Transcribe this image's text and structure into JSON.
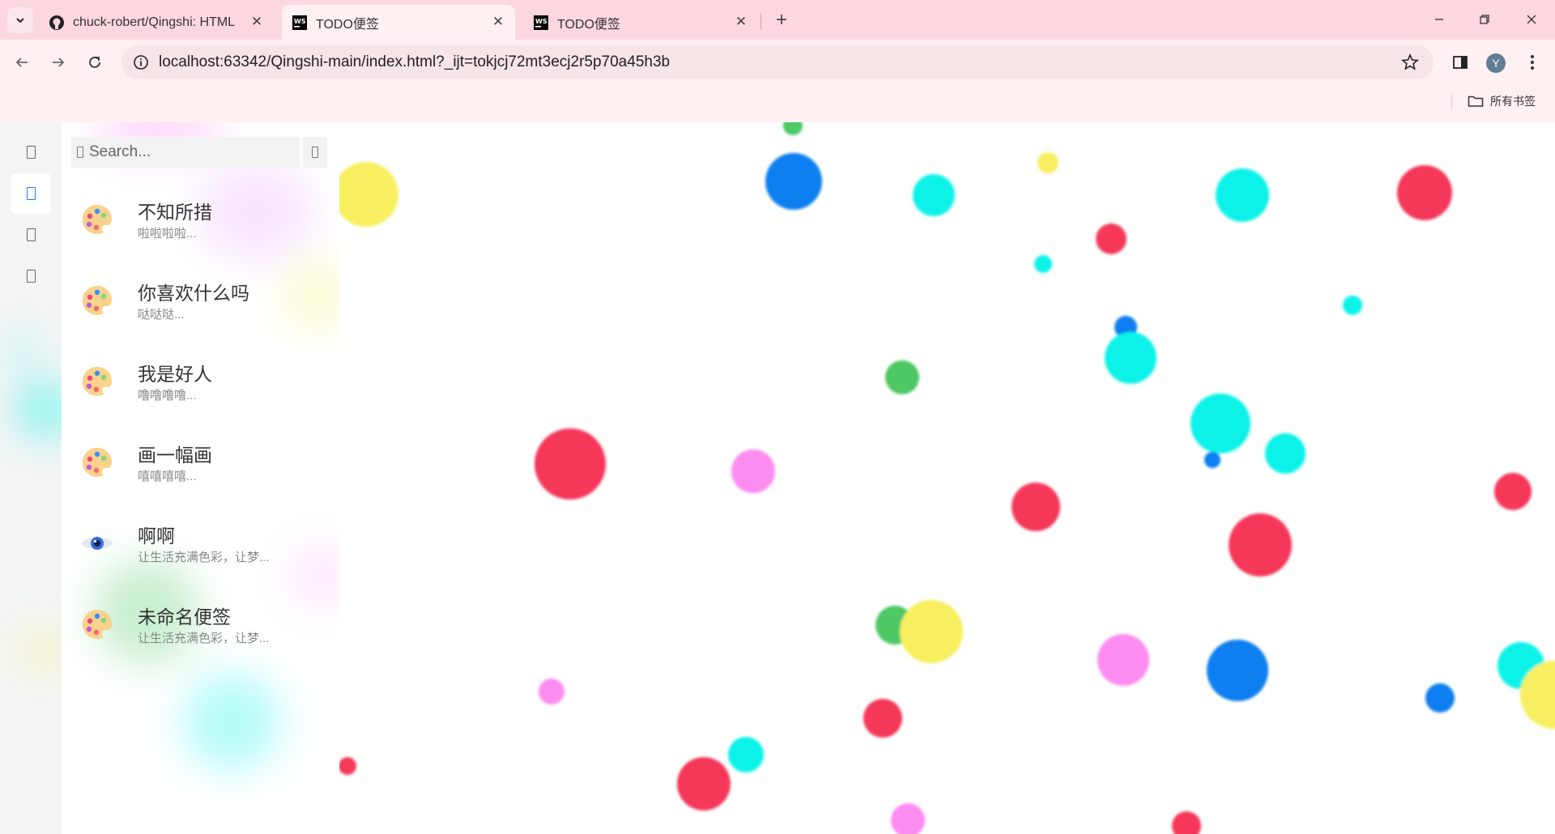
{
  "browser": {
    "tabs": [
      {
        "title": "chuck-robert/Qingshi: HTML",
        "icon": "github-icon",
        "active": false
      },
      {
        "title": "TODO便签",
        "icon": "webstorm-icon",
        "active": true
      },
      {
        "title": "TODO便签",
        "icon": "webstorm-icon",
        "active": false
      }
    ],
    "url": "localhost:63342/Qingshi-main/index.html?_ijt=tokjcj72mt3ecj2r5p70a45h3b",
    "avatar_letter": "Y",
    "bookmarks_label": "所有书签"
  },
  "app": {
    "rail_items": [
      {
        "icon": "placeholder-glyph-icon",
        "active": false
      },
      {
        "icon": "placeholder-glyph-icon",
        "active": true
      },
      {
        "icon": "placeholder-glyph-icon",
        "active": false
      },
      {
        "icon": "placeholder-glyph-icon",
        "active": false
      }
    ],
    "search": {
      "placeholder": "Search..."
    },
    "notes": [
      {
        "title": "不知所措",
        "preview": "啦啦啦啦...",
        "icon": "palette-icon"
      },
      {
        "title": "你喜欢什么吗",
        "preview": "哒哒哒...",
        "icon": "palette-icon"
      },
      {
        "title": "我是好人",
        "preview": "噜噜噜噜...",
        "icon": "palette-icon"
      },
      {
        "title": "画一幅画",
        "preview": "嘻嘻嘻嘻...",
        "icon": "palette-icon"
      },
      {
        "title": "啊啊",
        "preview": "让生活充满色彩，让梦...",
        "icon": "eye-icon"
      },
      {
        "title": "未命名便签",
        "preview": "让生活充满色彩，让梦...",
        "icon": "palette-icon"
      }
    ]
  },
  "colors": {
    "red": "#f5395a",
    "blue": "#0a7ff0",
    "cyan": "#0af2e8",
    "yellow": "#f7ef5e",
    "green": "#4ec865",
    "pink": "#fd8cf1",
    "accent": "#1c7ef0",
    "tabstrip": "#fdd7df"
  }
}
